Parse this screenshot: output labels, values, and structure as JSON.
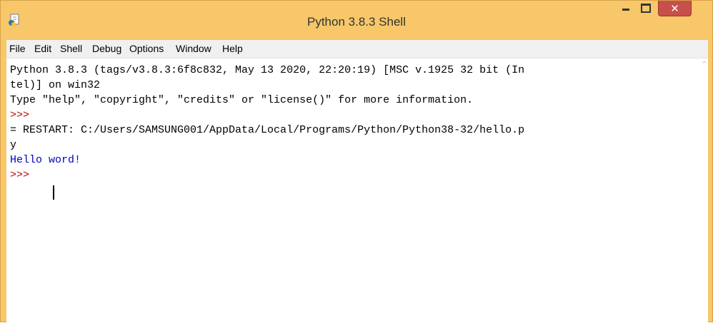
{
  "window": {
    "title": "Python 3.8.3 Shell",
    "titlebar_color": "#f7c76a",
    "close_button_color": "#c7504b",
    "icons": {
      "app": "idle-shell-icon",
      "minimize": "minimize-icon",
      "maximize": "maximize-icon",
      "close": "close-icon"
    },
    "close_glyph": "✕"
  },
  "menu": {
    "items": [
      {
        "label": "File"
      },
      {
        "label": "Edit"
      },
      {
        "label": "Shell"
      },
      {
        "label": "Debug"
      },
      {
        "label": "Options"
      },
      {
        "label": "Window"
      },
      {
        "label": "Help"
      }
    ]
  },
  "shell": {
    "lines": [
      {
        "text": "Python 3.8.3 (tags/v3.8.3:6f8c832, May 13 2020, 22:20:19) [MSC v.1925 32 bit (In",
        "kind": "output"
      },
      {
        "text": "tel)] on win32",
        "kind": "output"
      },
      {
        "text": "Type \"help\", \"copyright\", \"credits\" or \"license()\" for more information.",
        "kind": "output"
      },
      {
        "text": ">>>",
        "kind": "prompt"
      },
      {
        "text": "= RESTART: C:/Users/SAMSUNG001/AppData/Local/Programs/Python/Python38-32/hello.p",
        "kind": "output"
      },
      {
        "text": "y",
        "kind": "output"
      },
      {
        "text": "Hello word!",
        "kind": "stdout"
      },
      {
        "text": ">>>",
        "kind": "prompt"
      }
    ],
    "colors": {
      "prompt": "#c00000",
      "stdout": "#0000c0",
      "output": "#000000"
    }
  }
}
